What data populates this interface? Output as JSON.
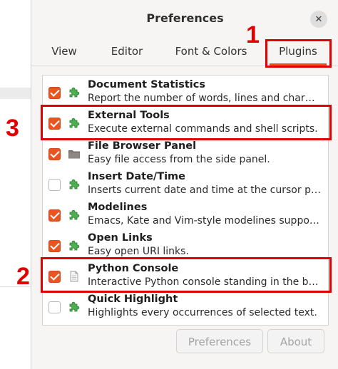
{
  "window": {
    "title": "Preferences"
  },
  "tabs": [
    {
      "label": "View",
      "active": false
    },
    {
      "label": "Editor",
      "active": false
    },
    {
      "label": "Font & Colors",
      "active": false
    },
    {
      "label": "Plugins",
      "active": true
    }
  ],
  "plugins": [
    {
      "name": "Document Statistics",
      "description": "Report the number of words, lines and char…",
      "enabled": true,
      "icon": "puzzle-icon"
    },
    {
      "name": "External Tools",
      "description": "Execute external commands and shell scripts.",
      "enabled": true,
      "icon": "puzzle-icon"
    },
    {
      "name": "File Browser Panel",
      "description": "Easy file access from the side panel.",
      "enabled": true,
      "icon": "folder-icon"
    },
    {
      "name": "Insert Date/Time",
      "description": "Inserts current date and time at the cursor p…",
      "enabled": false,
      "icon": "puzzle-icon"
    },
    {
      "name": "Modelines",
      "description": "Emacs, Kate and Vim-style modelines suppo…",
      "enabled": true,
      "icon": "puzzle-icon"
    },
    {
      "name": "Open Links",
      "description": "Easy open URI links.",
      "enabled": true,
      "icon": "puzzle-icon"
    },
    {
      "name": "Python Console",
      "description": "Interactive Python console standing in the b…",
      "enabled": true,
      "icon": "document-icon"
    },
    {
      "name": "Quick Highlight",
      "description": "Highlights every occurrences of selected text.",
      "enabled": false,
      "icon": "puzzle-icon"
    }
  ],
  "buttons": {
    "preferences": "Preferences",
    "about": "About"
  },
  "callouts": {
    "plugins_tab": "1",
    "python_console": "2",
    "external_tools": "3"
  },
  "colors": {
    "accent": "#e95420",
    "callout": "#e10000",
    "puzzle": "#4caf50"
  }
}
